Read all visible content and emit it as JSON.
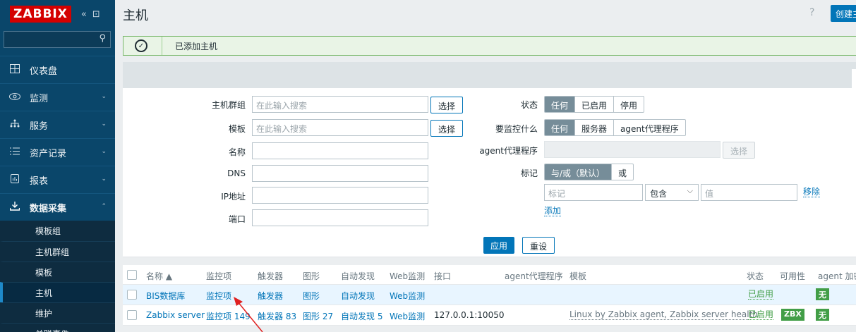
{
  "sidebar": {
    "logo": "ZABBIX",
    "collapse_icon": "«",
    "kiosk_icon": "⊡",
    "search_icon": "⚲",
    "items": [
      {
        "label": "仪表盘",
        "icon": "grid-icon"
      },
      {
        "label": "监测",
        "icon": "eye-icon"
      },
      {
        "label": "服务",
        "icon": "services-icon"
      },
      {
        "label": "资产记录",
        "icon": "list-icon"
      },
      {
        "label": "报表",
        "icon": "report-icon"
      },
      {
        "label": "数据采集",
        "icon": "download-icon"
      }
    ],
    "subitems": [
      "模板组",
      "主机群组",
      "模板",
      "主机",
      "维护",
      "关联事件"
    ]
  },
  "header": {
    "title": "主机",
    "help": "?",
    "create": "创建主机"
  },
  "message": {
    "text": "已添加主机"
  },
  "filter": {
    "host_groups": "主机群组",
    "templates": "模板",
    "name": "名称",
    "dns": "DNS",
    "ip": "IP地址",
    "port": "端口",
    "search_placeholder": "在此输入搜索",
    "select": "选择",
    "status": "状态",
    "status_opts": [
      "任何",
      "已启用",
      "停用"
    ],
    "monitored_by": "要监控什么",
    "monitored_opts": [
      "任何",
      "服务器",
      "agent代理程序"
    ],
    "proxy": "agent代理程序",
    "tags": "标记",
    "tags_opts": [
      "与/或（默认）",
      "或"
    ],
    "tag_placeholder": "标记",
    "tag_operator": "包含",
    "value_placeholder": "值",
    "remove": "移除",
    "add": "添加",
    "apply": "应用",
    "reset": "重设"
  },
  "table": {
    "headers": [
      "名称 ▲",
      "监控项",
      "触发器",
      "图形",
      "自动发现",
      "Web监测",
      "接口",
      "agent代理程序",
      "模板",
      "状态",
      "可用性",
      "agent 加密"
    ],
    "rows": [
      {
        "name": "BIS数据库",
        "items": "监控项",
        "triggers": "触发器",
        "graphs": "图形",
        "discovery": "自动发现",
        "web": "Web监测",
        "iface": "",
        "proxy": "",
        "templates": "",
        "status": "已启用",
        "avail": "",
        "enc": "无"
      },
      {
        "name": "Zabbix server",
        "items": "监控项 149",
        "triggers": "触发器 83",
        "graphs": "图形 27",
        "discovery": "自动发现 5",
        "web": "Web监测",
        "iface": "127.0.0.1:10050",
        "proxy": "",
        "templates": "Linux by Zabbix agent, Zabbix server health",
        "status": "已启用",
        "avail": "ZBX",
        "enc": "无"
      }
    ]
  },
  "colors": {
    "sidebar": "#0a466a",
    "accent": "#0275b8",
    "success": "#429e47",
    "logo": "#d40000",
    "arrow": "#e02020"
  }
}
